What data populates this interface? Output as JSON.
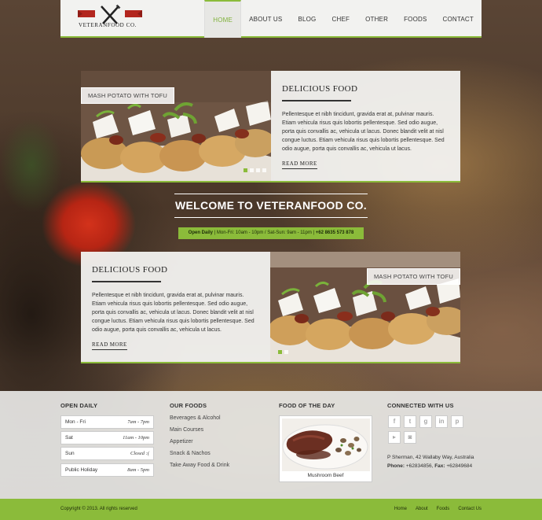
{
  "header": {
    "logo_text": "VETERANFOOD CO.",
    "nav": [
      "HOME",
      "ABOUT US",
      "BLOG",
      "CHEF",
      "OTHER",
      "FOODS",
      "CONTACT"
    ],
    "active_index": 0
  },
  "feature1": {
    "caption": "MASH POTATO WITH TOFU",
    "title": "DELICIOUS FOOD",
    "body": "Pellentesque et nibh tincidunt, gravida erat at, pulvinar mauris. Etiam vehicula risus quis lobortis pellentesque. Sed odio augue, porta quis convallis ac, vehicula ut lacus. Donec blandit velit at nisl congue luctus. Etiam vehicula risus quis lobortis pellentesque. Sed odio augue, porta quis convallis ac, vehicula ut lacus.",
    "read_more": "READ MORE"
  },
  "welcome": {
    "title": "WELCOME TO VETERANFOOD CO.",
    "open_label": "Open Daily",
    "hours_text": "| Mon-Fri: 10am - 10pm / Sat-Sun: 9am - 11pm |",
    "phone": "+62 8635 573 878"
  },
  "feature2": {
    "caption": "MASH POTATO WITH TOFU",
    "title": "DELICIOUS FOOD",
    "body": "Pellentesque et nibh tincidunt, gravida erat at, pulvinar mauris. Etiam vehicula risus quis lobortis pellentesque. Sed odio augue, porta quis convallis ac, vehicula ut lacus. Donec blandit velit at nisl congue luctus. Etiam vehicula risus quis lobortis pellentesque. Sed odio augue, porta quis convallis ac, vehicula ut lacus.",
    "read_more": "READ MORE"
  },
  "footer": {
    "open_daily_title": "OPEN DAILY",
    "hours": [
      {
        "day": "Mon - Fri",
        "time": "7am - 7pm"
      },
      {
        "day": "Sat",
        "time": "11am - 10pm"
      },
      {
        "day": "Sun",
        "time": "Closed :("
      },
      {
        "day": "Public Holiday",
        "time": "8am - 5pm"
      }
    ],
    "foods_title": "OUR FOODS",
    "foods": [
      "Beverages & Alcohol",
      "Main Courses",
      "Appetizer",
      "Snack & Nachos",
      "Take Away Food & Drink"
    ],
    "fotd_title": "FOOD OF THE DAY",
    "fotd_caption": "Mushroom Beef",
    "connected_title": "CONNECTED WITH US",
    "social": [
      "facebook-icon",
      "twitter-icon",
      "google-plus-icon",
      "linkedin-icon",
      "pinterest-icon",
      "instagram-icon"
    ],
    "address": "P Sherman, 42 Wallaby Way, Australia",
    "phone_label": "Phone:",
    "phone": "+62834856,",
    "fax_label": "Fax:",
    "fax": "+62849684"
  },
  "bottom": {
    "copyright": "Copyright © 2013. All rights reserved",
    "links": [
      "Home",
      "About",
      "Foods",
      "Contact Us"
    ]
  },
  "colors": {
    "accent": "#8bbb3a",
    "header_bg": "#f2f2f0"
  }
}
